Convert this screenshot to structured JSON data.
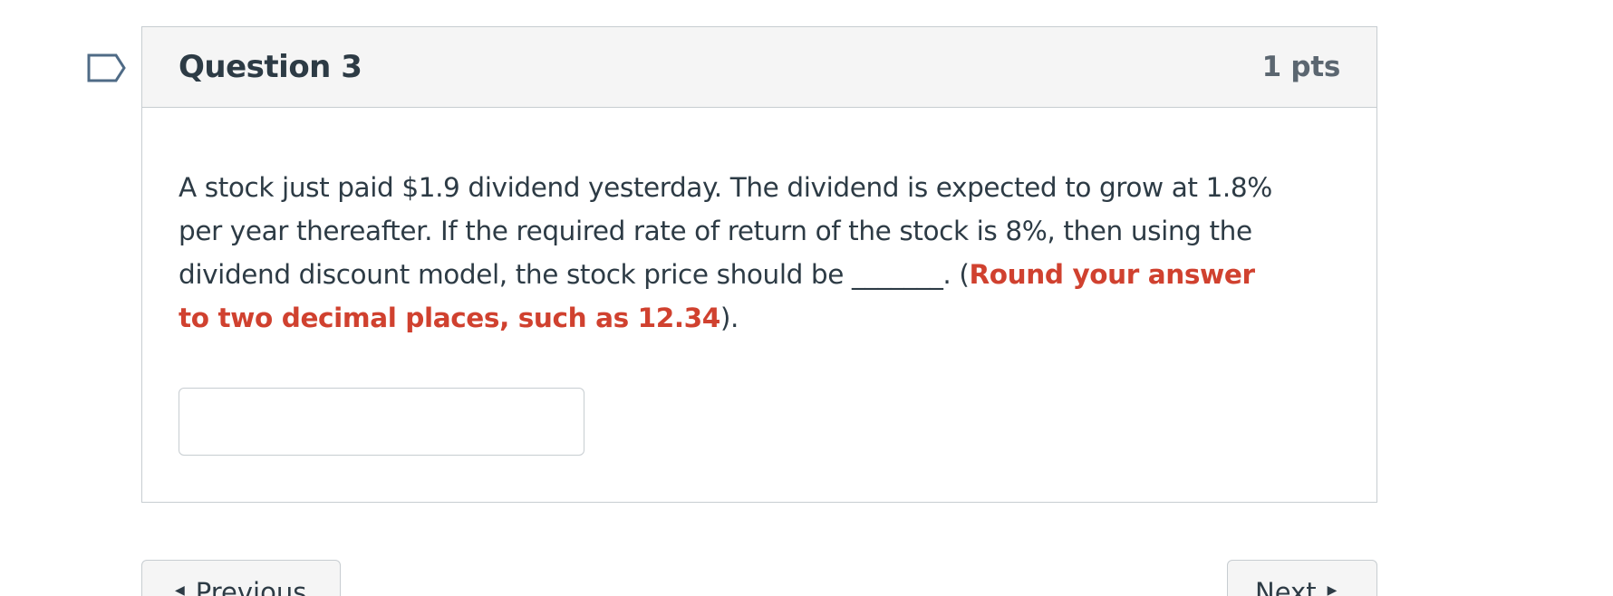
{
  "question": {
    "title": "Question 3",
    "points": "1 pts",
    "text_part1": "A stock just paid $1.9 dividend yesterday. The dividend is expected to grow at 1.8% per year thereafter. If the required rate of return of the stock is 8%, then using the dividend discount model, the stock price should be _______. (",
    "text_emphasis": "Round your answer to two decimal places, such as 12.34",
    "text_part2": ").",
    "answer_value": "",
    "emphasis_color": "#d0412f"
  },
  "navigation": {
    "previous_label": "Previous",
    "next_label": "Next",
    "previous_icon": "triangle-left-icon",
    "next_icon": "triangle-right-icon"
  },
  "icons": {
    "flag": "bookmark-flag-icon"
  }
}
